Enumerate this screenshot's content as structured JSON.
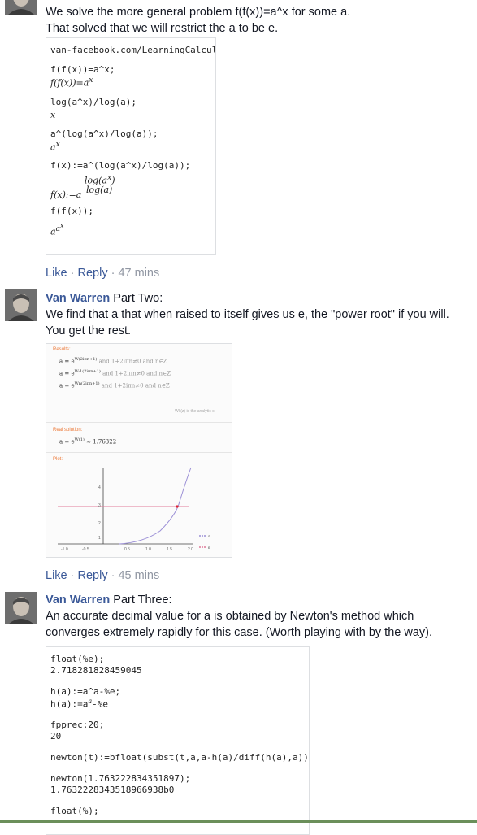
{
  "comment1": {
    "line1": "We solve the more general problem f(f(x))=a^x for some a.",
    "line2": "That solved that we will restrict the a to be e.",
    "code": {
      "header": "van-facebook.com/LearningCalculus$",
      "l1": "f(f(x))=a^x;",
      "l1out": "f(f(x))=a",
      "l1sup": "x",
      "l2": "log(a^x)/log(a);",
      "l2out": "x",
      "l3": "a^(log(a^x)/log(a));",
      "l3out": "a",
      "l3sup": "x",
      "l4": "f(x):=a^(log(a^x)/log(a));",
      "l4num": "log(a",
      "l4numsup": "x",
      "l4den": "log(a)",
      "l4prefix": "f(x):=a",
      "l5": "f(f(x));",
      "l5out": "a",
      "l5sup": "a",
      "l5supsup": "x"
    },
    "like": "Like",
    "reply": "Reply",
    "time": "47 mins"
  },
  "comment2": {
    "author": "Van Warren",
    "title_rest": " Part Two:",
    "line1": "We find that a that when raised to itself gives us e, the \"power root\" if you will.",
    "line2": "You get the rest.",
    "wolfram": {
      "results_label": "Results:",
      "r1": "a = e",
      "r1sup": "W(2iπn+1)",
      "r1cond": "and 1+2iπn≠0 and n∈Z",
      "r2": "a = e",
      "r2sup": "W-1(2iπn+1)",
      "r2cond": "and 1+2iπn≠0 and n∈Z",
      "r3": "a = e",
      "r3sup": "Wn(2iπn+1)",
      "r3cond": "and 1+2iπn≠0 and n∈Z",
      "note": "Wk(z) is the analytic c",
      "real_label": "Real solution:",
      "real": "a = e",
      "realsup": "W(1)",
      "realval": "≈ 1.76322",
      "plot_label": "Plot:"
    },
    "like": "Like",
    "reply": "Reply",
    "time": "45 mins"
  },
  "comment3": {
    "author": "Van Warren",
    "title_rest": " Part Three:",
    "line1": "An accurate decimal value for a is obtained by Newton's method which",
    "line2": "converges extremely rapidly for this case. (Worth playing with by the way).",
    "code": {
      "l1": "float(%e);",
      "l1out": "2.718281828459045",
      "l2": "h(a):=a^a-%e;",
      "l2out": "h(a):=a",
      "l2outsup": "a",
      "l2outrest": "-%e",
      "l3": "fpprec:20;",
      "l3out": "20",
      "l4": "newton(t):=bfloat(subst(t,a,a-h(a)/diff(h(a),a)))$",
      "l5": "newton(1.763222834351897);",
      "l5out": "1.7632228343518966938b0",
      "l6": "float(%);"
    }
  },
  "plot": {
    "xticks": [
      "-1.0",
      "-0.5",
      "0.5",
      "1.0",
      "1.5",
      "2.0"
    ],
    "yticks": [
      "4",
      "3",
      "2",
      "1"
    ],
    "legend1": "a",
    "legend2": "e"
  },
  "colors": {
    "link": "#3b5998",
    "meta": "#9197a3",
    "curve": "#9b8fd6",
    "hline": "#e07b9a"
  }
}
